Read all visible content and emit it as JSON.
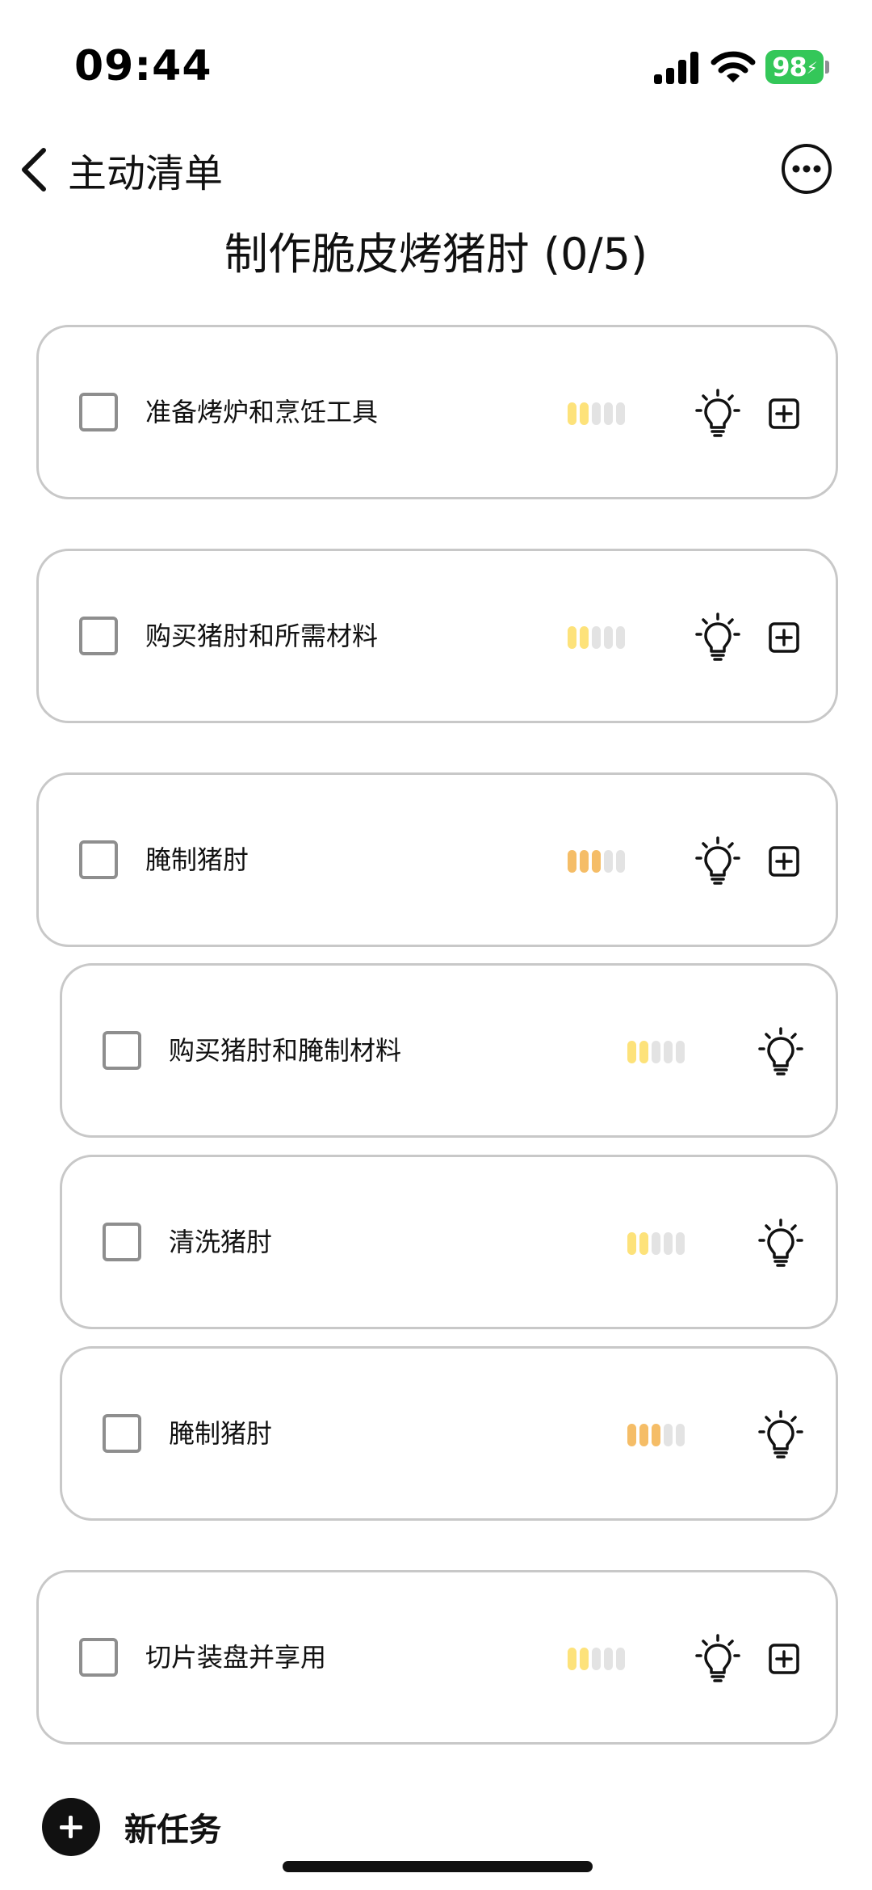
{
  "status_bar": {
    "time": "09:44",
    "battery": "98",
    "signal_icon": "cellular-signal-icon",
    "wifi_icon": "wifi-icon"
  },
  "nav": {
    "back_label": "主动清单",
    "back_icon": "chevron-left-icon",
    "more_icon": "ellipsis-circle-icon"
  },
  "page_title": "制作脆皮烤猪肘 (0/5)",
  "colors": {
    "easy": "#fde27a",
    "medium": "#f5bd67",
    "empty": "#e3e3e3",
    "battery": "#34c759"
  },
  "tasks": [
    {
      "label": "准备烤炉和烹饪工具",
      "difficulty": 2,
      "level": "easy",
      "subtask": false,
      "has_add": true
    },
    {
      "label": "购买猪肘和所需材料",
      "difficulty": 2,
      "level": "easy",
      "subtask": false,
      "has_add": true
    },
    {
      "label": "腌制猪肘",
      "difficulty": 3,
      "level": "medium",
      "subtask": false,
      "has_add": true
    },
    {
      "label": "购买猪肘和腌制材料",
      "difficulty": 2,
      "level": "easy",
      "subtask": true,
      "has_add": false
    },
    {
      "label": "清洗猪肘",
      "difficulty": 2,
      "level": "easy",
      "subtask": true,
      "has_add": false
    },
    {
      "label": "腌制猪肘",
      "difficulty": 3,
      "level": "medium",
      "subtask": true,
      "has_add": false
    },
    {
      "label": "切片装盘并享用",
      "difficulty": 2,
      "level": "easy",
      "subtask": false,
      "has_add": true
    }
  ],
  "new_task": {
    "label": "新任务",
    "icon": "plus-circle-icon"
  }
}
